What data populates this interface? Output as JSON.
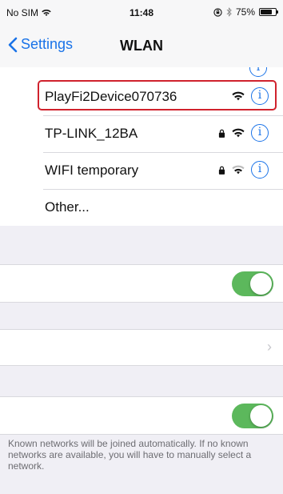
{
  "status_bar": {
    "carrier": "No SIM",
    "time": "11:48",
    "battery_percent": "75%",
    "battery_level": 0.75
  },
  "nav": {
    "back_label": "Settings",
    "title": "WLAN"
  },
  "networks": [
    {
      "name": "PlayFi2Device070736",
      "locked": false,
      "highlighted": true
    },
    {
      "name": "TP-LINK_12BA",
      "locked": true,
      "highlighted": false
    },
    {
      "name": "WIFI temporary",
      "locked": true,
      "highlighted": false
    },
    {
      "name": "Other..."
    }
  ],
  "toggles": {
    "first_on": true,
    "second_on": true
  },
  "footer_note": "Known networks will be joined automatically. If no known networks are available, you will have to manually select a network.",
  "colors": {
    "accent": "#1a73e8",
    "toggle_on": "#5cb85c",
    "highlight_border": "#d0222d"
  }
}
